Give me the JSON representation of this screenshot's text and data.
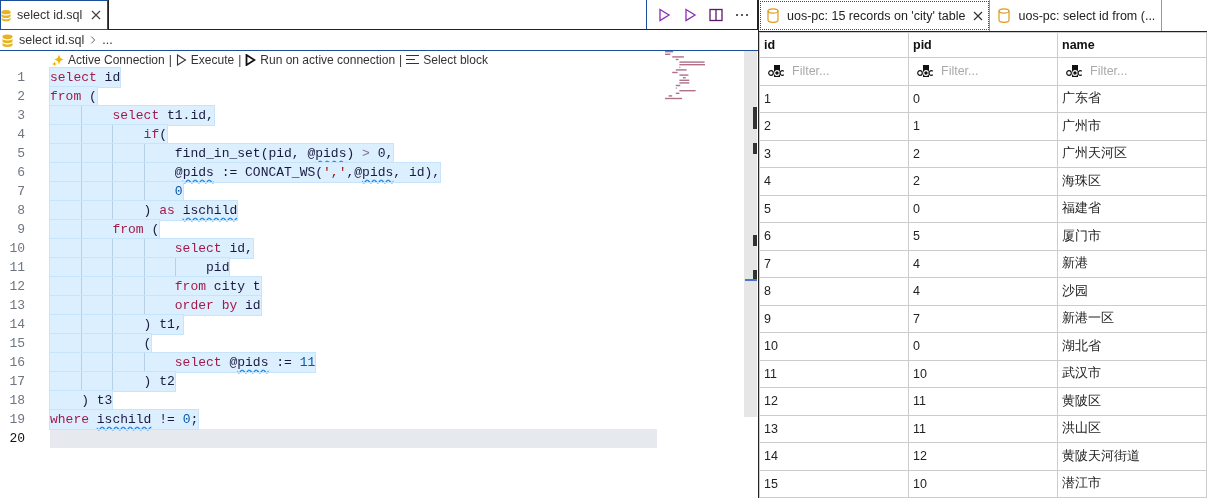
{
  "editor": {
    "tab": {
      "label": "select id.sql",
      "selected": true
    },
    "breadcrumb": [
      "select id.sql",
      "..."
    ],
    "codelens": [
      {
        "kind": "sparkle",
        "label": "Active Connection"
      },
      {
        "kind": "separator",
        "label": "|"
      },
      {
        "kind": "play",
        "label": "Execute"
      },
      {
        "kind": "separator",
        "label": "|"
      },
      {
        "kind": "play-bold",
        "label": "Run on active connection"
      },
      {
        "kind": "separator",
        "label": "|"
      },
      {
        "kind": "lines",
        "label": "Select block"
      }
    ],
    "lines": [
      {
        "number": "1",
        "selected": true,
        "current": false,
        "tokens": [
          {
            "kind": "keyword",
            "text": "select"
          },
          {
            "kind": "text",
            "text": " id"
          }
        ]
      },
      {
        "number": "2",
        "selected": true,
        "current": false,
        "tokens": [
          {
            "kind": "keyword",
            "text": "from"
          },
          {
            "kind": "text",
            "text": " ("
          }
        ]
      },
      {
        "number": "3",
        "selected": true,
        "current": false,
        "tokens": [
          {
            "kind": "keyword",
            "text": "        select"
          },
          {
            "kind": "text",
            "text": " t1.id,"
          }
        ]
      },
      {
        "number": "4",
        "selected": true,
        "current": false,
        "tokens": [
          {
            "kind": "keyword",
            "text": "            if"
          },
          {
            "kind": "text",
            "text": "("
          }
        ]
      },
      {
        "number": "5",
        "selected": true,
        "current": false,
        "tokens": [
          {
            "kind": "text",
            "text": "                find_in_set(pid, @"
          },
          {
            "kind": "text",
            "text": "pids",
            "warning": true
          },
          {
            "kind": "text",
            "text": ") "
          },
          {
            "kind": "operator",
            "text": ">"
          },
          {
            "kind": "text",
            "text": " 0,"
          }
        ]
      },
      {
        "number": "6",
        "selected": true,
        "current": false,
        "tokens": [
          {
            "kind": "text",
            "text": "                @"
          },
          {
            "kind": "text",
            "text": "pids",
            "warning": true
          },
          {
            "kind": "text",
            "text": " := CONCAT_WS("
          },
          {
            "kind": "string",
            "text": "','"
          },
          {
            "kind": "text",
            "text": ",@"
          },
          {
            "kind": "text",
            "text": "pids",
            "warning": true
          },
          {
            "kind": "text",
            "text": ", id),"
          }
        ]
      },
      {
        "number": "7",
        "selected": true,
        "current": false,
        "tokens": [
          {
            "kind": "number",
            "text": "                0"
          }
        ]
      },
      {
        "number": "8",
        "selected": true,
        "current": false,
        "tokens": [
          {
            "kind": "text",
            "text": "            ) "
          },
          {
            "kind": "keyword",
            "text": "as "
          },
          {
            "kind": "text",
            "text": "ischild",
            "warning": true
          }
        ]
      },
      {
        "number": "9",
        "selected": true,
        "current": false,
        "tokens": [
          {
            "kind": "keyword",
            "text": "        from"
          },
          {
            "kind": "text",
            "text": " ("
          }
        ]
      },
      {
        "number": "10",
        "selected": true,
        "current": false,
        "tokens": [
          {
            "kind": "keyword",
            "text": "                select"
          },
          {
            "kind": "text",
            "text": " id,"
          }
        ]
      },
      {
        "number": "11",
        "selected": true,
        "current": false,
        "tokens": [
          {
            "kind": "text",
            "text": "                    pid"
          }
        ]
      },
      {
        "number": "12",
        "selected": true,
        "current": false,
        "tokens": [
          {
            "kind": "keyword",
            "text": "                from"
          },
          {
            "kind": "text",
            "text": " city t"
          }
        ]
      },
      {
        "number": "13",
        "selected": true,
        "current": false,
        "tokens": [
          {
            "kind": "keyword",
            "text": "                order by"
          },
          {
            "kind": "text",
            "text": " id"
          }
        ]
      },
      {
        "number": "14",
        "selected": true,
        "current": false,
        "tokens": [
          {
            "kind": "text",
            "text": "            ) t1,"
          }
        ]
      },
      {
        "number": "15",
        "selected": true,
        "current": false,
        "tokens": [
          {
            "kind": "text",
            "text": "            ("
          }
        ]
      },
      {
        "number": "16",
        "selected": true,
        "current": false,
        "tokens": [
          {
            "kind": "keyword",
            "text": "                select"
          },
          {
            "kind": "text",
            "text": " @"
          },
          {
            "kind": "text",
            "text": "pids",
            "warning": true
          },
          {
            "kind": "text",
            "text": " := "
          },
          {
            "kind": "number",
            "text": "11"
          }
        ]
      },
      {
        "number": "17",
        "selected": true,
        "current": false,
        "tokens": [
          {
            "kind": "text",
            "text": "            ) t2"
          }
        ]
      },
      {
        "number": "18",
        "selected": true,
        "current": false,
        "tokens": [
          {
            "kind": "text",
            "text": "    ) t3"
          }
        ]
      },
      {
        "number": "19",
        "selected": true,
        "current": false,
        "tokens": [
          {
            "kind": "keyword",
            "text": "where "
          },
          {
            "kind": "text",
            "text": "ischild",
            "warning": true
          },
          {
            "kind": "text",
            "text": " != "
          },
          {
            "kind": "number",
            "text": "0"
          },
          {
            "kind": "text",
            "text": ";"
          }
        ]
      },
      {
        "number": "20",
        "selected": false,
        "current": true
      }
    ]
  },
  "results": {
    "tabs": [
      {
        "label": "uos-pc: 15 records on 'city' table",
        "selected": true,
        "closable": true
      },
      {
        "label": "uos-pc: select id from (...",
        "selected": false,
        "closable": false
      }
    ],
    "columns": [
      {
        "name": "id",
        "filter_placeholder": "Filter..."
      },
      {
        "name": "pid",
        "filter_placeholder": "Filter..."
      },
      {
        "name": "name",
        "filter_placeholder": "Filter..."
      }
    ],
    "rows": [
      [
        "1",
        "0",
        "广东省"
      ],
      [
        "2",
        "1",
        "广州市"
      ],
      [
        "3",
        "2",
        "广州天河区"
      ],
      [
        "4",
        "2",
        "海珠区"
      ],
      [
        "5",
        "0",
        "福建省"
      ],
      [
        "6",
        "5",
        "厦门市"
      ],
      [
        "7",
        "4",
        "新港"
      ],
      [
        "8",
        "4",
        "沙园"
      ],
      [
        "9",
        "7",
        "新港一区"
      ],
      [
        "10",
        "0",
        "湖北省"
      ],
      [
        "11",
        "10",
        "武汉市"
      ],
      [
        "12",
        "11",
        "黄陂区"
      ],
      [
        "13",
        "11",
        "洪山区"
      ],
      [
        "14",
        "12",
        "黄陂天河街道"
      ],
      [
        "15",
        "10",
        "潜江市"
      ]
    ]
  }
}
